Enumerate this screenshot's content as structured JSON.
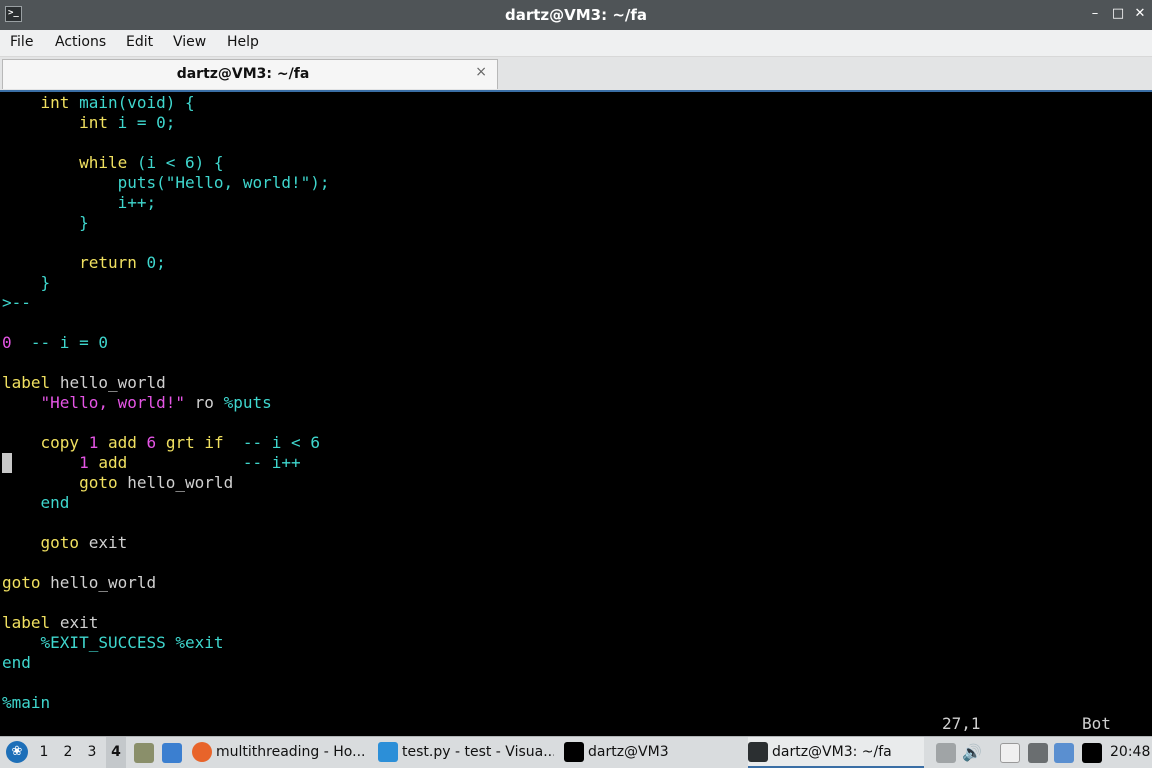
{
  "window": {
    "title": "dartz@VM3: ~/fa",
    "minimize": "–",
    "maximize": "□",
    "close": "✕"
  },
  "menubar": {
    "items": [
      "File",
      "Actions",
      "Edit",
      "View",
      "Help"
    ]
  },
  "tab": {
    "label": "dartz@VM3: ~/fa",
    "close": "×"
  },
  "terminal": {
    "lines": [
      "    int main(void) {",
      "        int i = 0;",
      "",
      "        while (i < 6) {",
      "            puts(\"Hello, world!\");",
      "            i++;",
      "        }",
      "",
      "        return 0;",
      "    }",
      ">--",
      "",
      "0  -- i = 0",
      "",
      "label hello_world",
      "    \"Hello, world!\" ro %puts",
      "",
      "    copy 1 add 6 grt if  -- i < 6",
      "        1 add            -- i++",
      "        goto hello_world",
      "    end",
      "",
      "    goto exit",
      "",
      "goto hello_world",
      "",
      "label exit",
      "    %EXIT_SUCCESS %exit",
      "end",
      "",
      "%main"
    ],
    "status_position": "27,1",
    "status_scroll": "Bot",
    "colors": {
      "cyan": "#3fd7ce",
      "yellow": "#f0e060",
      "magenta": "#e555e5",
      "plain": "#d0d0d0"
    }
  },
  "taskbar": {
    "workspaces": [
      "1",
      "2",
      "3",
      "4"
    ],
    "active_workspace": "4",
    "tasks": [
      {
        "label": "multithreading - Ho...",
        "icon": "firefox-icon"
      },
      {
        "label": "test.py - test - Visua...",
        "icon": "vscode-icon"
      },
      {
        "label": "dartz@VM3",
        "icon": "terminal-icon"
      },
      {
        "label": "dartz@VM3: ~/fa",
        "icon": "terminal-icon"
      }
    ],
    "clock": "20:48"
  }
}
